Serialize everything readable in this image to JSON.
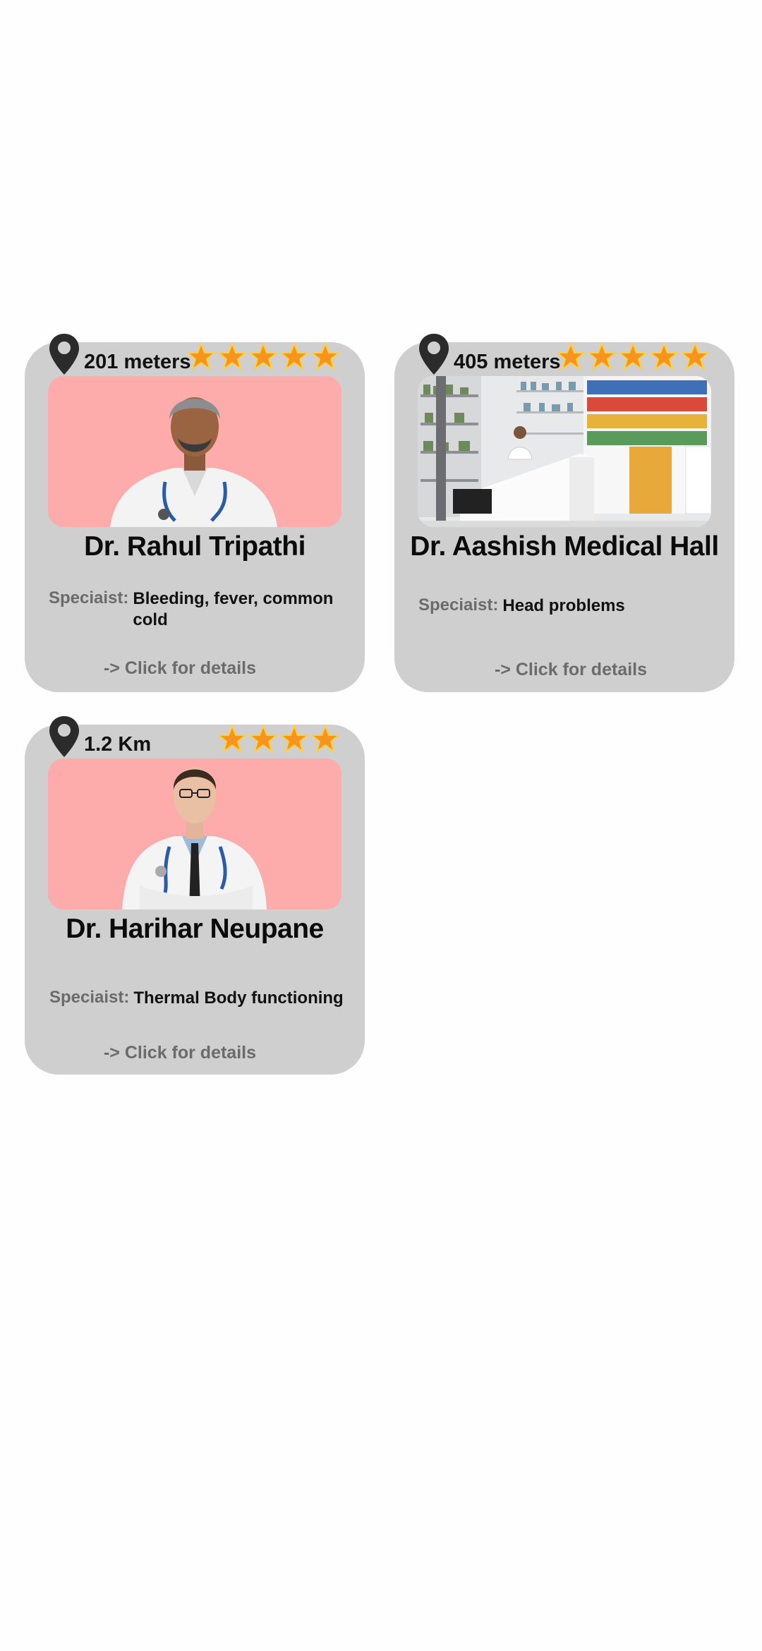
{
  "cards": [
    {
      "distance": "201 meters",
      "rating": 5,
      "name": "Dr. Rahul Tripathi",
      "specialist_label": "Speciaist:",
      "specialist_value": "Bleeding, fever,  common cold",
      "details_label": "-> Click for details"
    },
    {
      "distance": "405 meters",
      "rating": 5,
      "name": "Dr. Aashish Medical Hall",
      "specialist_label": "Speciaist:",
      "specialist_value": "Head problems",
      "details_label": "-> Click for details"
    },
    {
      "distance": "1.2 Km",
      "rating": 4,
      "name": "Dr. Harihar Neupane",
      "specialist_label": "Speciaist:",
      "specialist_value": "Thermal Body functioning",
      "details_label": "-> Click for details"
    }
  ],
  "icons": {
    "location": "location-pin-icon",
    "rating": "star-icon"
  },
  "colors": {
    "card_bg": "#cfcfcf",
    "photo_bg": "#fdabab",
    "star_fill": "#f7941d",
    "star_glow": "#ffd23f",
    "label_gray": "#6b6b6b",
    "pin": "#2b2b2b"
  }
}
